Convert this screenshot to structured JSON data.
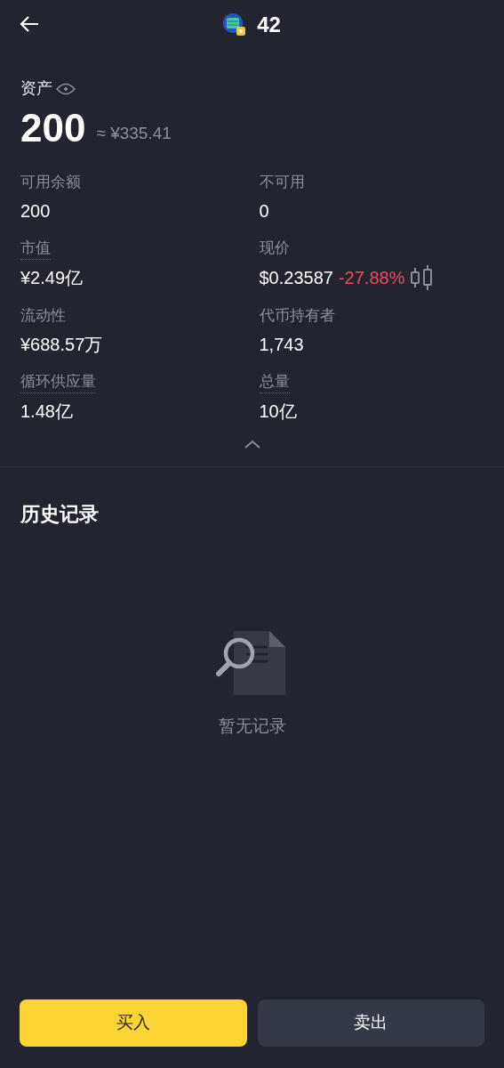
{
  "header": {
    "title": "42"
  },
  "assets": {
    "label": "资产",
    "amount": "200",
    "approx": "≈ ¥335.41"
  },
  "stats": [
    {
      "kind": "plain",
      "label": "可用余额",
      "underlined": false,
      "value": "200"
    },
    {
      "kind": "plain",
      "label": "不可用",
      "underlined": false,
      "value": "0"
    },
    {
      "kind": "plain",
      "label": "市值",
      "underlined": true,
      "value": "¥2.49亿"
    },
    {
      "kind": "price",
      "label": "现价",
      "underlined": false,
      "value": "$0.23587",
      "change": "-27.88%"
    },
    {
      "kind": "plain",
      "label": "流动性",
      "underlined": false,
      "value": "¥688.57万"
    },
    {
      "kind": "plain",
      "label": "代币持有者",
      "underlined": false,
      "value": "1,743"
    },
    {
      "kind": "plain",
      "label": "循环供应量",
      "underlined": true,
      "value": "1.48亿"
    },
    {
      "kind": "plain",
      "label": "总量",
      "underlined": true,
      "value": "10亿"
    }
  ],
  "history": {
    "title": "历史记录",
    "empty_text": "暂无记录"
  },
  "buttons": [
    {
      "kind": "buy",
      "label": "买入"
    },
    {
      "kind": "sell",
      "label": "卖出"
    }
  ]
}
